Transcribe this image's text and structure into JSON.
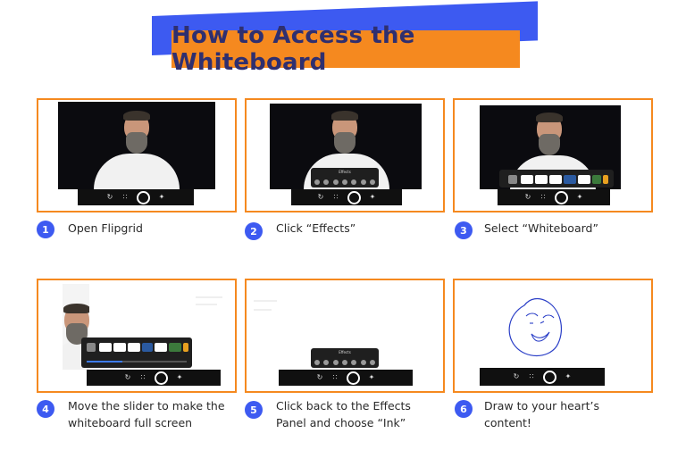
{
  "title": "How to Access the Whiteboard",
  "steps": [
    {
      "number": "1",
      "caption": "Open Flipgrid"
    },
    {
      "number": "2",
      "caption": "Click “Effects”"
    },
    {
      "number": "3",
      "caption": "Select “Whiteboard”"
    },
    {
      "number": "4",
      "caption": "Move the slider to make the whiteboard full screen"
    },
    {
      "number": "5",
      "caption": "Click back to the Effects Panel and choose “Ink”"
    },
    {
      "number": "6",
      "caption": "Draw to your heart’s content!"
    }
  ],
  "colors": {
    "accent_orange": "#f5891f",
    "accent_blue": "#3d5af1",
    "title_text": "#2f2f6f",
    "ink": "#2b3fc7"
  },
  "icons": [
    "refresh-icon",
    "grid-icon",
    "record-icon",
    "effects-wand-icon"
  ]
}
